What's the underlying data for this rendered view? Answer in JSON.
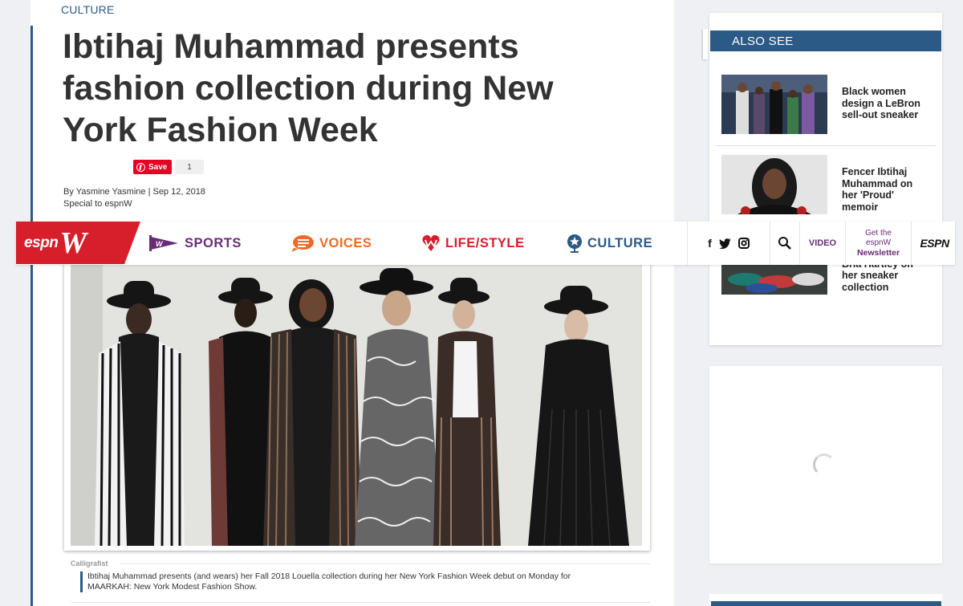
{
  "article": {
    "kicker": "CULTURE",
    "headline": "Ibtihaj Muhammad presents fashion collection during New York Fashion Week",
    "save_label": "Save",
    "save_count": "1",
    "byline": "By Yasmine Yasmine | Sep 12, 2018",
    "byline_sub": "Special to espnW",
    "photo_credit": "Calligrafist",
    "caption": "Ibtihaj Muhammad presents (and wears) her Fall 2018 Louella collection during her New York Fashion Week debut on Monday for MAARKAH: New York Modest Fashion Show."
  },
  "nav": {
    "logo_text": "espn",
    "logo_w": "W",
    "items": [
      {
        "label": "SPORTS",
        "icon": "pennant-icon"
      },
      {
        "label": "VOICES",
        "icon": "speech-bubble-icon"
      },
      {
        "label": "LIFE/STYLE",
        "icon": "heart-w-icon"
      },
      {
        "label": "CULTURE",
        "icon": "globe-star-icon"
      }
    ],
    "social": [
      "f",
      "twitter",
      "instagram"
    ],
    "video_label": "VIDEO",
    "newsletter_line1": "Get the",
    "newsletter_line2": "espnW",
    "newsletter_line3": "Newsletter",
    "espn_label": "ESPN"
  },
  "sidebar": {
    "heading": "ALSO SEE",
    "stories": [
      {
        "title": "Black women design a LeBron sell-out sneaker"
      },
      {
        "title": "Fencer Ibtihaj Muhammad on her 'Proud' memoir"
      },
      {
        "title": "Liberty guard Bria Hartley on her sneaker collection"
      }
    ]
  },
  "colors": {
    "brand_red": "#d71e2b",
    "culture_blue": "#2b5a86",
    "sports_purple": "#6a2a77",
    "voices_orange": "#ee6a28"
  }
}
